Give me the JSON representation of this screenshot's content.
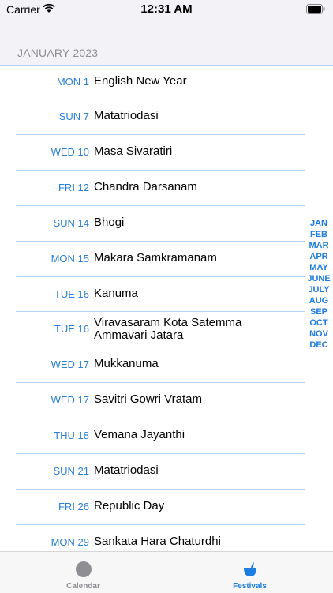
{
  "status_bar": {
    "carrier": "Carrier",
    "time": "12:31 AM"
  },
  "section": {
    "header": "JANUARY 2023"
  },
  "festivals": [
    {
      "date": "MON 1",
      "name": "English New Year"
    },
    {
      "date": "SUN 7",
      "name": "Matatriodasi"
    },
    {
      "date": "WED 10",
      "name": "Masa Sivaratiri"
    },
    {
      "date": "FRI 12",
      "name": "Chandra Darsanam"
    },
    {
      "date": "SUN 14",
      "name": "Bhogi"
    },
    {
      "date": "MON 15",
      "name": "Makara Samkramanam"
    },
    {
      "date": "TUE 16",
      "name": "Kanuma"
    },
    {
      "date": "TUE 16",
      "name": "Viravasaram Kota Satemma Ammavari Jatara"
    },
    {
      "date": "WED 17",
      "name": "Mukkanuma"
    },
    {
      "date": "WED 17",
      "name": "Savitri Gowri Vratam"
    },
    {
      "date": "THU 18",
      "name": "Vemana Jayanthi"
    },
    {
      "date": "SUN 21",
      "name": "Matatriodasi"
    },
    {
      "date": "FRI 26",
      "name": "Republic Day"
    },
    {
      "date": "MON 29",
      "name": "Sankata Hara Chaturdhi"
    }
  ],
  "month_index": [
    "JAN",
    "FEB",
    "MAR",
    "APR",
    "MAY",
    "JUNE",
    "JULY",
    "AUG",
    "SEP",
    "OCT",
    "NOV",
    "DEC"
  ],
  "tabs": [
    {
      "label": "Calendar",
      "icon": "circle-icon",
      "selected": false
    },
    {
      "label": "Festivals",
      "icon": "pot-icon",
      "selected": true
    }
  ],
  "colors": {
    "accent": "#1e7de0",
    "date_text": "#2a80d8",
    "separator": "#b3d4f5",
    "header_bg": "#f2f2f7"
  }
}
